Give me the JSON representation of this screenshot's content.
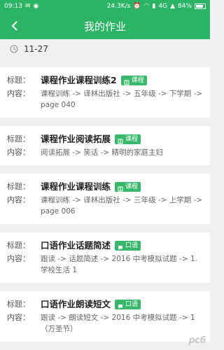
{
  "status": {
    "time": "09:13",
    "speed": "24.3K/s",
    "network": "4G",
    "battery": "84%",
    "battery_level": 0.84
  },
  "header": {
    "title": "我的作业"
  },
  "date": "11-27",
  "labels": {
    "title": "标题：",
    "content": "内容："
  },
  "items": [
    {
      "title": "课程作业课程训练2",
      "badge": "课程",
      "content": "课程训练 -> 译林出版社 -> 五年级 -> 下学期 -> page 040"
    },
    {
      "title": "课程作业阅读拓展",
      "badge": "课程",
      "content": "阅读拓展 -> 笑话 -> 精明的家庭主妇"
    },
    {
      "title": "课程作业课程训练",
      "badge": "课程",
      "content": "课程训练 -> 译林出版社 -> 三年级 -> 上学期 -> page 006"
    },
    {
      "title": "口语作业话题简述",
      "badge": "口语",
      "content": "跟读 -> 话题简述 -> 2016 中考模拟试题 -> 1.学校生活 1"
    },
    {
      "title": "口语作业朗读短文",
      "badge": "口语",
      "content": "跟读 -> 朗读短文 -> 2016 中考模拟试题 -> 1（万圣节）"
    }
  ],
  "watermark": "pc6"
}
